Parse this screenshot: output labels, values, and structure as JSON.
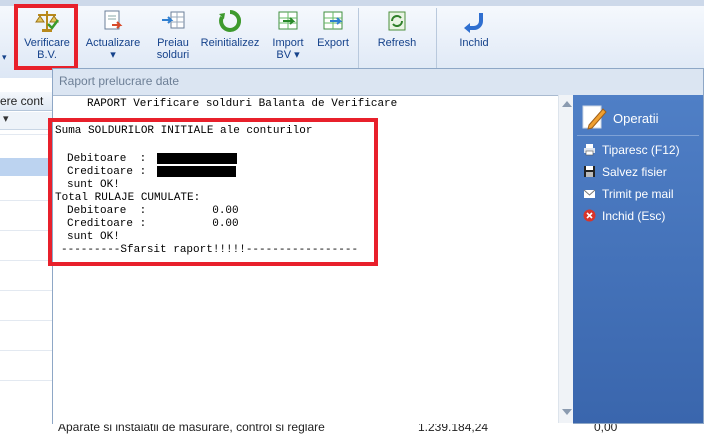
{
  "toolbar": {
    "verificare_l1": "Verificare",
    "verificare_l2": "B.V.",
    "actualizare": "Actualizare",
    "preiau_l1": "Preiau",
    "preiau_l2": "solduri",
    "reinitializez": "Reinitializez",
    "import_l1": "Import",
    "import_l2": "BV",
    "export": "Export",
    "refresh": "Refresh",
    "inchid": "Inchid"
  },
  "background": {
    "header_text": "ere cont",
    "bottom_desc": "Aparate si instalatii de masurare, control si reglare",
    "bottom_val1": "1.239.184,24",
    "bottom_val2": "0,00"
  },
  "dialog": {
    "title": "Raport prelucrare date",
    "report": {
      "heading": "RAPORT Verificare solduri Balanta de Verificare",
      "line_suma": "Suma SOLDURILOR INITIALE ale conturilor",
      "debitoare_label": "Debitoare  :",
      "creditoare_label": "Creditoare :",
      "ok1": "sunt OK!",
      "total_rulaje": "Total RULAJE CUMULATE:",
      "debitoare2": "Debitoare  :          0.00",
      "creditoare2": "Creditoare :          0.00",
      "ok2": "sunt OK!",
      "end": "---------Sfarsit raport!!!!!-----------------"
    }
  },
  "side_panel": {
    "title": "Operatii",
    "items": [
      "Tiparesc (F12)",
      "Salvez fisier",
      "Trimit pe mail",
      "Inchid (Esc)"
    ]
  },
  "colors": {
    "highlight": "#e8202b",
    "panel": "#3a66ad",
    "ribbon_text": "#15428b"
  }
}
